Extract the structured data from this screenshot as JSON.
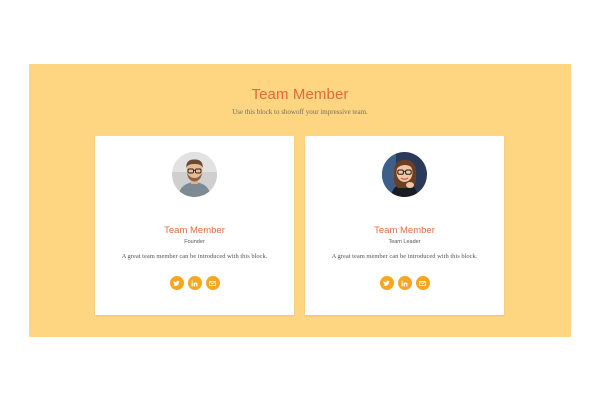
{
  "section": {
    "title": "Team Member",
    "subtitle": "Use this block to showoff your impressive team."
  },
  "members": [
    {
      "name": "Team Member",
      "role": "Founder",
      "description": "A great team member can be introduced with this block.",
      "avatar_icon": "avatar-man-icon"
    },
    {
      "name": "Team Member",
      "role": "Team Leader",
      "description": "A great team member can be introduced with this block.",
      "avatar_icon": "avatar-woman-icon"
    }
  ],
  "social_icons": [
    "twitter-icon",
    "linkedin-icon",
    "email-icon"
  ],
  "colors": {
    "section_bg": "#fed580",
    "accent": "#e2693b",
    "social_bg": "#f7a623",
    "card_bg": "#ffffff"
  }
}
